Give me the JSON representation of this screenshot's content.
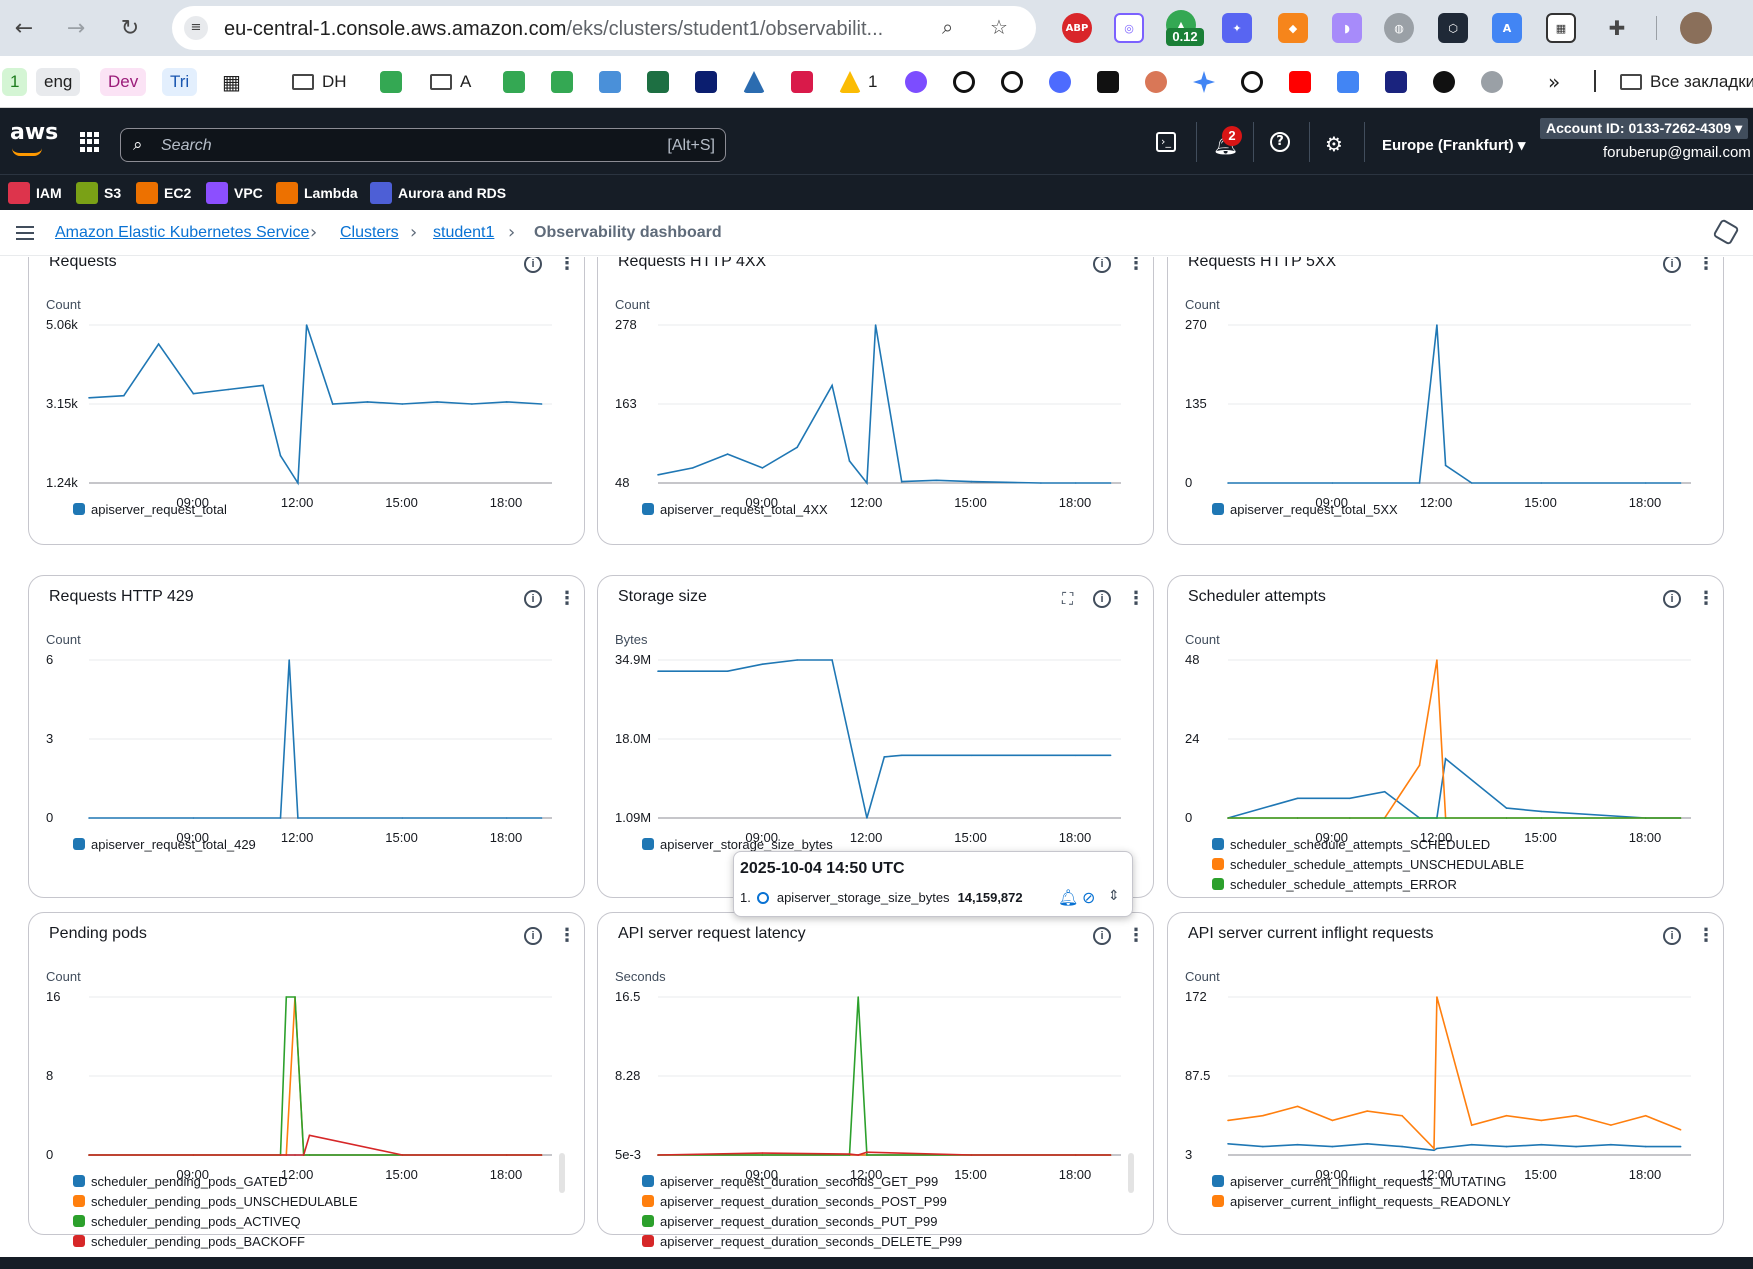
{
  "browser": {
    "url_host": "eu-central-1.console.aws.amazon.com",
    "url_path": "/eks/clusters/student1/observabilit...",
    "extension_badge": "0.12",
    "ext_abp": "ABP",
    "bookmarks": {
      "b1": "1",
      "eng": "eng",
      "dev": "Dev",
      "tri": "Tri",
      "dh": "DH",
      "a": "A",
      "drive_count": "1",
      "all_bookmarks": "Все закладки"
    }
  },
  "aws": {
    "logo": "aws",
    "search_placeholder": "Search",
    "search_hint": "[Alt+S]",
    "notifications_count": "2",
    "region": "Europe (Frankfurt) ▾",
    "account": "Account ID: 0133-7262-4309 ▾",
    "email": "foruberup@gmail.com",
    "favorites": [
      "IAM",
      "S3",
      "EC2",
      "VPC",
      "Lambda",
      "Aurora and RDS"
    ],
    "favorite_colors": [
      "#dd344c",
      "#7aa116",
      "#ed7100",
      "#8c4fff",
      "#ed7100",
      "#4d5fd6"
    ]
  },
  "breadcrumb": {
    "items": [
      "Amazon Elastic Kubernetes Service",
      "Clusters",
      "student1"
    ],
    "current": "Observability dashboard"
  },
  "colors": {
    "blue": "#1f77b4",
    "orange": "#ff7f0e",
    "green": "#2ca02c",
    "red": "#d62728"
  },
  "panels": [
    {
      "title": "Requests",
      "unit": "Count",
      "yticks": [
        "5.06k",
        "3.15k",
        "1.24k"
      ],
      "xticks": [
        "09:00",
        "12:00",
        "15:00",
        "18:00"
      ],
      "legend": [
        {
          "label": "apiserver_request_total",
          "color": "#1f77b4"
        }
      ],
      "info": "i"
    },
    {
      "title": "Requests HTTP 4XX",
      "unit": "Count",
      "yticks": [
        "278",
        "163",
        "48"
      ],
      "xticks": [
        "09:00",
        "12:00",
        "15:00",
        "18:00"
      ],
      "legend": [
        {
          "label": "apiserver_request_total_4XX",
          "color": "#1f77b4"
        }
      ],
      "info": "i"
    },
    {
      "title": "Requests HTTP 5XX",
      "unit": "Count",
      "yticks": [
        "270",
        "135",
        "0"
      ],
      "xticks": [
        "09:00",
        "12:00",
        "15:00",
        "18:00"
      ],
      "legend": [
        {
          "label": "apiserver_request_total_5XX",
          "color": "#1f77b4"
        }
      ],
      "info": "i"
    },
    {
      "title": "Requests HTTP 429",
      "unit": "Count",
      "yticks": [
        "6",
        "3",
        "0"
      ],
      "xticks": [
        "09:00",
        "12:00",
        "15:00",
        "18:00"
      ],
      "legend": [
        {
          "label": "apiserver_request_total_429",
          "color": "#1f77b4"
        }
      ],
      "info": "i"
    },
    {
      "title": "Storage size",
      "unit": "Bytes",
      "yticks": [
        "34.9M",
        "18.0M",
        "1.09M"
      ],
      "xticks": [
        "09:00",
        "12:00",
        "15:00",
        "18:00"
      ],
      "legend": [
        {
          "label": "apiserver_storage_size_bytes",
          "color": "#1f77b4"
        }
      ],
      "info": "i"
    },
    {
      "title": "Scheduler attempts",
      "unit": "Count",
      "yticks": [
        "48",
        "24",
        "0"
      ],
      "xticks": [
        "09:00",
        "12:00",
        "15:00",
        "18:00"
      ],
      "legend": [
        {
          "label": "scheduler_schedule_attempts_SCHEDULED",
          "color": "#1f77b4"
        },
        {
          "label": "scheduler_schedule_attempts_UNSCHEDULABLE",
          "color": "#ff7f0e"
        },
        {
          "label": "scheduler_schedule_attempts_ERROR",
          "color": "#2ca02c"
        }
      ],
      "info": "i"
    },
    {
      "title": "Pending pods",
      "unit": "Count",
      "yticks": [
        "16",
        "8",
        "0"
      ],
      "xticks": [
        "09:00",
        "12:00",
        "15:00",
        "18:00"
      ],
      "legend": [
        {
          "label": "scheduler_pending_pods_GATED",
          "color": "#1f77b4"
        },
        {
          "label": "scheduler_pending_pods_UNSCHEDULABLE",
          "color": "#ff7f0e"
        },
        {
          "label": "scheduler_pending_pods_ACTIVEQ",
          "color": "#2ca02c"
        },
        {
          "label": "scheduler_pending_pods_BACKOFF",
          "color": "#d62728"
        }
      ],
      "info": "i"
    },
    {
      "title": "API server request latency",
      "unit": "Seconds",
      "yticks": [
        "16.5",
        "8.28",
        "5e-3"
      ],
      "xticks": [
        "09:00",
        "12:00",
        "15:00",
        "18:00"
      ],
      "legend": [
        {
          "label": "apiserver_request_duration_seconds_GET_P99",
          "color": "#1f77b4"
        },
        {
          "label": "apiserver_request_duration_seconds_POST_P99",
          "color": "#ff7f0e"
        },
        {
          "label": "apiserver_request_duration_seconds_PUT_P99",
          "color": "#2ca02c"
        },
        {
          "label": "apiserver_request_duration_seconds_DELETE_P99",
          "color": "#d62728"
        }
      ],
      "info": "i"
    },
    {
      "title": "API server current inflight requests",
      "unit": "Count",
      "yticks": [
        "172",
        "87.5",
        "3"
      ],
      "xticks": [
        "09:00",
        "12:00",
        "15:00",
        "18:00"
      ],
      "legend": [
        {
          "label": "apiserver_current_inflight_requests_MUTATING",
          "color": "#1f77b4"
        },
        {
          "label": "apiserver_current_inflight_requests_READONLY",
          "color": "#ff7f0e"
        }
      ],
      "info": "i"
    }
  ],
  "tooltip": {
    "time": "2025-10-04 14:50 UTC",
    "index": "1.",
    "series": "apiserver_storage_size_bytes",
    "value": "14,159,872"
  },
  "chart_data": [
    {
      "type": "line",
      "title": "Requests",
      "ylabel": "Count",
      "ylim": [
        1240,
        5060
      ],
      "x": [
        "06:00",
        "07:00",
        "08:00",
        "09:00",
        "10:00",
        "11:00",
        "11:30",
        "12:00",
        "12:15",
        "13:00",
        "14:00",
        "15:00",
        "16:00",
        "17:00",
        "18:00",
        "19:00"
      ],
      "series": [
        {
          "name": "apiserver_request_total",
          "values": [
            3300,
            3350,
            4600,
            3400,
            3500,
            3600,
            1900,
            1240,
            5060,
            3150,
            3200,
            3150,
            3200,
            3150,
            3200,
            3150
          ]
        }
      ]
    },
    {
      "type": "line",
      "title": "Requests HTTP 4XX",
      "ylabel": "Count",
      "ylim": [
        48,
        278
      ],
      "x": [
        "06:00",
        "07:00",
        "08:00",
        "09:00",
        "10:00",
        "11:00",
        "11:30",
        "12:00",
        "12:15",
        "13:00",
        "14:00",
        "15:00",
        "16:00",
        "17:00",
        "18:00",
        "19:00"
      ],
      "series": [
        {
          "name": "apiserver_request_total_4XX",
          "values": [
            60,
            70,
            90,
            70,
            100,
            190,
            80,
            48,
            278,
            50,
            52,
            50,
            49,
            48,
            48,
            48
          ]
        }
      ]
    },
    {
      "type": "line",
      "title": "Requests HTTP 5XX",
      "ylabel": "Count",
      "ylim": [
        0,
        270
      ],
      "x": [
        "06:00",
        "09:00",
        "11:30",
        "12:00",
        "12:15",
        "13:00",
        "15:00",
        "18:00",
        "19:00"
      ],
      "series": [
        {
          "name": "apiserver_request_total_5XX",
          "values": [
            0,
            0,
            0,
            270,
            30,
            0,
            0,
            0,
            0
          ]
        }
      ]
    },
    {
      "type": "line",
      "title": "Requests HTTP 429",
      "ylabel": "Count",
      "ylim": [
        0,
        6
      ],
      "x": [
        "06:00",
        "09:00",
        "11:30",
        "11:45",
        "12:00",
        "15:00",
        "18:00",
        "19:00"
      ],
      "series": [
        {
          "name": "apiserver_request_total_429",
          "values": [
            0,
            0,
            0,
            6,
            0,
            0,
            0,
            0
          ]
        }
      ]
    },
    {
      "type": "line",
      "title": "Storage size",
      "ylabel": "Bytes",
      "ylim": [
        1090000,
        34900000
      ],
      "x": [
        "06:00",
        "08:00",
        "09:00",
        "10:00",
        "11:00",
        "12:00",
        "12:30",
        "13:00",
        "15:00",
        "18:00",
        "19:00"
      ],
      "series": [
        {
          "name": "apiserver_storage_size_bytes",
          "values": [
            32500000,
            32500000,
            34000000,
            34900000,
            34900000,
            1090000,
            14159872,
            14500000,
            14500000,
            14500000,
            14500000
          ]
        }
      ]
    },
    {
      "type": "line",
      "title": "Scheduler attempts",
      "ylabel": "Count",
      "ylim": [
        0,
        48
      ],
      "x": [
        "06:00",
        "08:00",
        "09:30",
        "10:30",
        "11:30",
        "12:00",
        "12:15",
        "14:00",
        "15:00",
        "18:00",
        "19:00"
      ],
      "series": [
        {
          "name": "scheduler_schedule_attempts_SCHEDULED",
          "values": [
            0,
            6,
            6,
            8,
            0,
            0,
            18,
            3,
            2,
            0,
            0
          ]
        },
        {
          "name": "scheduler_schedule_attempts_UNSCHEDULABLE",
          "values": [
            0,
            0,
            0,
            0,
            16,
            48,
            0,
            0,
            0,
            0,
            0
          ]
        },
        {
          "name": "scheduler_schedule_attempts_ERROR",
          "values": [
            0,
            0,
            0,
            0,
            0,
            0,
            0,
            0,
            0,
            0,
            0
          ]
        }
      ]
    },
    {
      "type": "line",
      "title": "Pending pods",
      "ylabel": "Count",
      "ylim": [
        0,
        16
      ],
      "x": [
        "06:00",
        "09:00",
        "11:30",
        "11:40",
        "11:55",
        "12:10",
        "12:20",
        "15:00",
        "18:00",
        "19:00"
      ],
      "series": [
        {
          "name": "scheduler_pending_pods_GATED",
          "values": [
            0,
            0,
            0,
            0,
            0,
            0,
            0,
            0,
            0,
            0
          ]
        },
        {
          "name": "scheduler_pending_pods_UNSCHEDULABLE",
          "values": [
            0,
            0,
            0,
            0,
            16,
            0,
            0,
            0,
            0,
            0
          ]
        },
        {
          "name": "scheduler_pending_pods_ACTIVEQ",
          "values": [
            0,
            0,
            0,
            16,
            16,
            0,
            0,
            0,
            0,
            0
          ]
        },
        {
          "name": "scheduler_pending_pods_BACKOFF",
          "values": [
            0,
            0,
            0,
            0,
            0,
            0,
            2,
            0,
            0,
            0
          ]
        }
      ]
    },
    {
      "type": "line",
      "title": "API server request latency",
      "ylabel": "Seconds",
      "ylim": [
        0.005,
        16.5
      ],
      "x": [
        "06:00",
        "09:00",
        "11:30",
        "11:45",
        "12:00",
        "15:00",
        "18:00",
        "19:00"
      ],
      "series": [
        {
          "name": "apiserver_request_duration_seconds_GET_P99",
          "values": [
            0.005,
            0.005,
            0.005,
            0.005,
            0.005,
            0.005,
            0.005,
            0.005
          ]
        },
        {
          "name": "apiserver_request_duration_seconds_POST_P99",
          "values": [
            0.005,
            0.005,
            0.005,
            0.005,
            0.005,
            0.005,
            0.005,
            0.005
          ]
        },
        {
          "name": "apiserver_request_duration_seconds_PUT_P99",
          "values": [
            0.005,
            0.005,
            0.005,
            16.5,
            0.005,
            0.005,
            0.005,
            0.005
          ]
        },
        {
          "name": "apiserver_request_duration_seconds_DELETE_P99",
          "values": [
            0.005,
            0.2,
            0.1,
            0.005,
            0.3,
            0.005,
            0.005,
            0.005
          ]
        }
      ]
    },
    {
      "type": "line",
      "title": "API server current inflight requests",
      "ylabel": "Count",
      "ylim": [
        3,
        172
      ],
      "x": [
        "06:00",
        "07:00",
        "08:00",
        "09:00",
        "10:00",
        "11:00",
        "11:55",
        "12:00",
        "13:00",
        "14:00",
        "15:00",
        "16:00",
        "17:00",
        "18:00",
        "19:00"
      ],
      "series": [
        {
          "name": "apiserver_current_inflight_requests_MUTATING",
          "values": [
            15,
            12,
            14,
            12,
            15,
            12,
            8,
            10,
            14,
            12,
            14,
            12,
            14,
            12,
            12
          ]
        },
        {
          "name": "apiserver_current_inflight_requests_READONLY",
          "values": [
            40,
            45,
            55,
            40,
            50,
            45,
            10,
            172,
            35,
            45,
            40,
            45,
            35,
            45,
            30
          ]
        }
      ]
    }
  ]
}
